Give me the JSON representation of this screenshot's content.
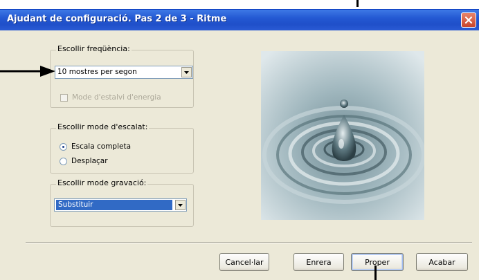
{
  "window": {
    "title": "Ajudant de configuració. Pas 2 de 3 - Ritme"
  },
  "frequency": {
    "group_title": "Escollir freqüència:",
    "selected": "10 mostres per segon",
    "power_save_label": "Mode d'estalvi d'energia",
    "power_save_checked": false,
    "power_save_enabled": false
  },
  "scale": {
    "group_title": "Escollir mode d'escalat:",
    "options": [
      "Escala completa",
      "Desplaçar"
    ],
    "selected_index": 0
  },
  "record": {
    "group_title": "Escollir mode gravació:",
    "selected": "Substituir"
  },
  "buttons": {
    "cancel": "Cancel·lar",
    "back": "Enrera",
    "next": "Proper",
    "finish": "Acabar"
  },
  "colors": {
    "titlebar": "#2459d3",
    "dialog_bg": "#ece9d8",
    "selection": "#316ac5"
  }
}
